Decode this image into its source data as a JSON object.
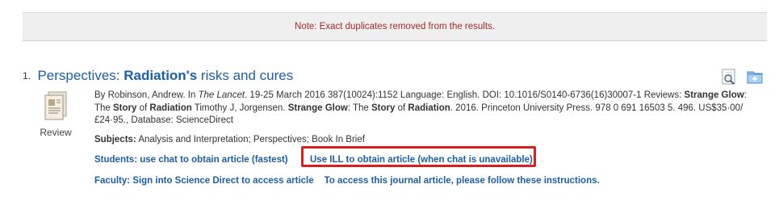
{
  "notice": {
    "text": "Note: Exact duplicates removed from the results."
  },
  "record": {
    "number": "1.",
    "title_parts": [
      "Perspectives: ",
      "Radiation's",
      " risks and cures"
    ],
    "format_label": "Review",
    "citation": {
      "p1": "By Robinson, Andrew. In ",
      "journal": "The Lancet",
      "p2": ". 19-25 March 2016 387(10024):1152 Language: English. DOI: 10.1016/S0140-6736(16)30007-1 Reviews: ",
      "hl1": "Strange Glow",
      "p3": ": The ",
      "hl2": "Story",
      "p4": " of ",
      "hl3": "Radiation",
      "p5": " Timothy J, Jorgensen. ",
      "hl4": "Strange Glow",
      "p6": ": The ",
      "hl5": "Story",
      "p7": " of ",
      "hl6": "Radiation",
      "p8": ". 2016. Princeton University Press. 978 0 691 16503 5. 496. US$35·00/£24·95., Database: ScienceDirect"
    },
    "subjects_label": "Subjects:",
    "subjects_value": " Analysis and Interpretation; Perspectives; Book In Brief",
    "links": {
      "students_chat": "Students: use chat to obtain article (fastest)",
      "ill": "Use ILL to obtain article (when chat is unavailable)",
      "faculty": "Faculty: Sign into Science Direct to access article",
      "instructions": "To access this journal article, please follow these instructions."
    }
  },
  "icons": {
    "preview": "magnifier-preview-icon",
    "add_folder": "add-to-folder-icon",
    "format": "review-document-icon"
  },
  "colors": {
    "link": "#1d5ea8",
    "notice_text": "#a8292a",
    "highlight_box": "#d81f1f"
  }
}
